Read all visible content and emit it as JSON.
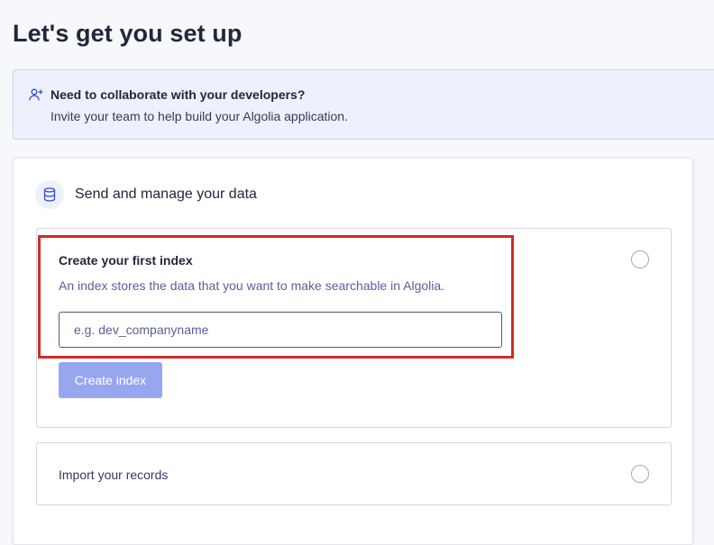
{
  "page": {
    "title": "Let's get you set up"
  },
  "banner": {
    "icon": "add-user-icon",
    "title": "Need to collaborate with your developers?",
    "text": "Invite your team to help build your Algolia application."
  },
  "section": {
    "icon": "database-icon",
    "title": "Send and manage your data"
  },
  "steps": [
    {
      "title": "Create your first index",
      "description": "An index stores the data that you want to make searchable in Algolia.",
      "input": {
        "value": "",
        "placeholder": "e.g. dev_companyname"
      },
      "button_label": "Create index",
      "button_color": "#97a7ef"
    },
    {
      "title": "Import your records"
    }
  ],
  "colors": {
    "highlight": "#d42a2a",
    "accent": "#5468ff"
  }
}
